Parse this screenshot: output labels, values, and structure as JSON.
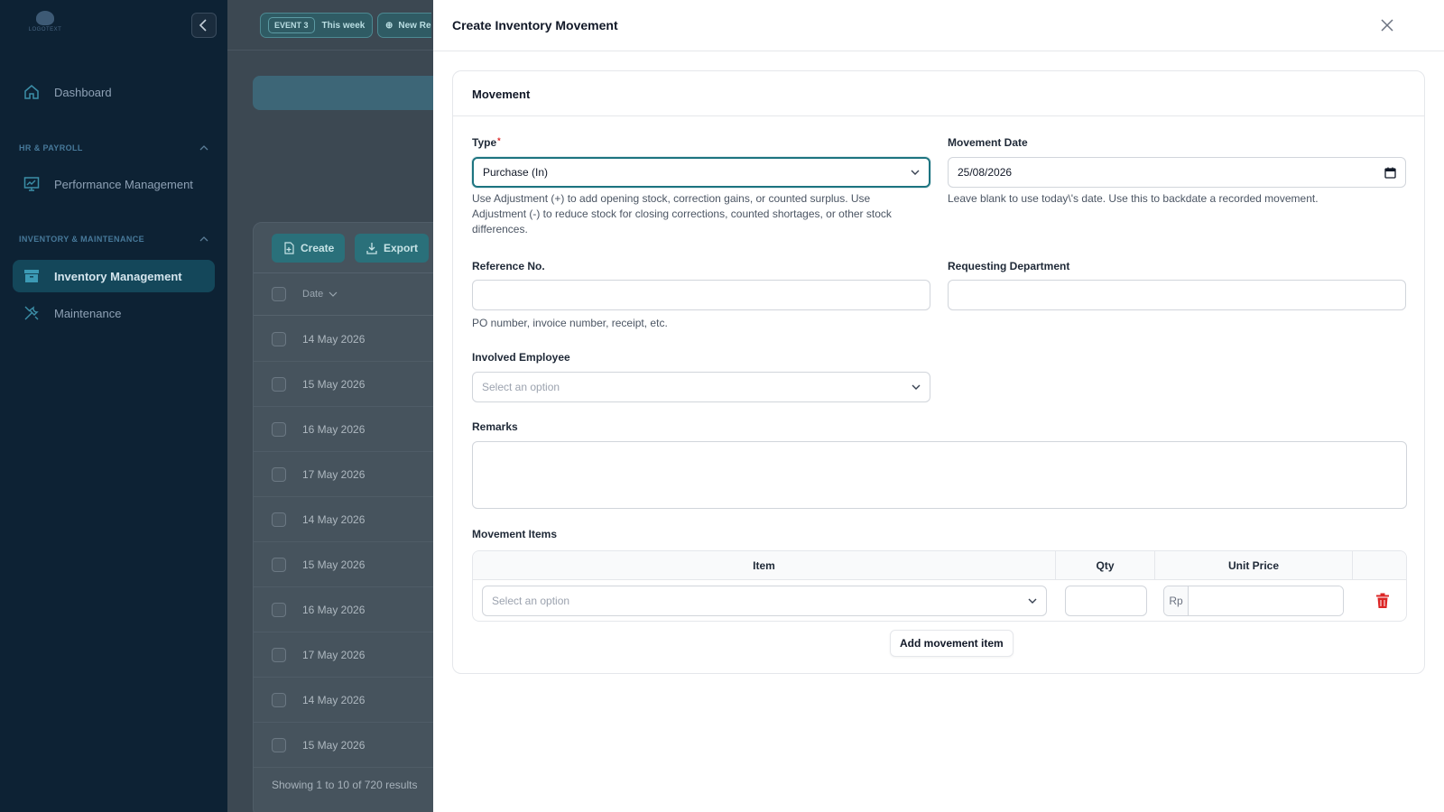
{
  "sidebar": {
    "logo_text": "LOGOTEXT",
    "items": {
      "dashboard": "Dashboard",
      "performance": "Performance Management",
      "inventory": "Inventory Management",
      "maintenance": "Maintenance"
    },
    "sections": {
      "hr": "HR & PAYROLL",
      "inventory": "INVENTORY & MAINTENANCE"
    }
  },
  "topbar": {
    "event_tag": "EVENT 3",
    "event_label": "This week",
    "new_label": "New Re"
  },
  "table": {
    "create_label": "Create",
    "export_label": "Export",
    "date_header": "Date",
    "rows": [
      "14 May 2026",
      "15 May 2026",
      "16 May 2026",
      "17 May 2026",
      "14 May 2026",
      "15 May 2026",
      "16 May 2026",
      "17 May 2026",
      "14 May 2026",
      "15 May 2026"
    ],
    "footer": "Showing 1 to 10 of 720 results"
  },
  "modal": {
    "title": "Create Inventory Movement",
    "section_title": "Movement",
    "type": {
      "label": "Type",
      "required_mark": "*",
      "value": "Purchase (In)",
      "help": "Use Adjustment (+) to add opening stock, correction gains, or counted surplus. Use Adjustment (-) to reduce stock for closing corrections, counted shortages, or other stock differences."
    },
    "movement_date": {
      "label": "Movement Date",
      "value": "25/08/2026",
      "help": "Leave blank to use today\\'s date. Use this to backdate a recorded movement."
    },
    "reference": {
      "label": "Reference No.",
      "value": "",
      "help": "PO number, invoice number, receipt, etc."
    },
    "department": {
      "label": "Requesting Department",
      "value": ""
    },
    "employee": {
      "label": "Involved Employee",
      "placeholder": "Select an option"
    },
    "remarks": {
      "label": "Remarks",
      "value": ""
    },
    "items": {
      "label": "Movement Items",
      "headers": {
        "item": "Item",
        "qty": "Qty",
        "unit_price": "Unit Price"
      },
      "row": {
        "item_placeholder": "Select an option",
        "qty": "",
        "currency": "Rp",
        "price": ""
      },
      "add_label": "Add movement item"
    }
  },
  "colors": {
    "accent": "#1d7480",
    "danger": "#dc2626",
    "sidebar_bg": "#0d2234"
  }
}
